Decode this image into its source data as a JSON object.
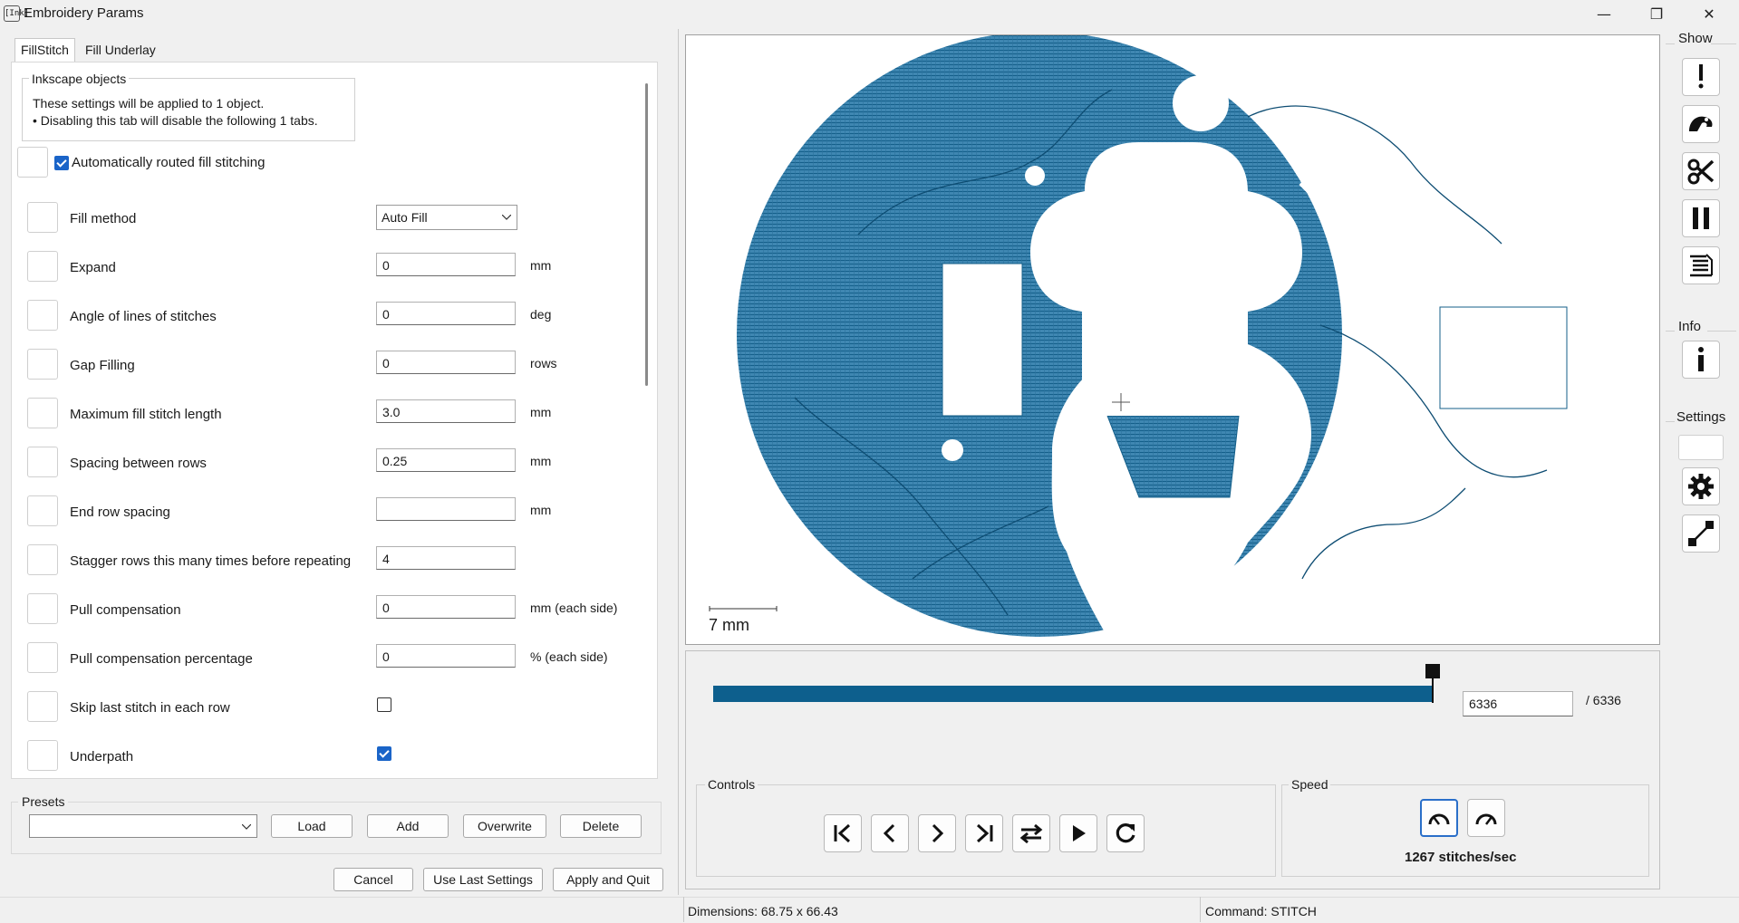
{
  "window": {
    "title": "Embroidery Params",
    "icon_text": "[Ink]",
    "minimize_glyph": "—",
    "restore_glyph": "❐",
    "close_glyph": "✕"
  },
  "tabs": {
    "fill_stitch": "FillStitch",
    "fill_underlay": "Fill Underlay"
  },
  "inkscape_objects": {
    "legend": "Inkscape objects",
    "line1": "These settings will be applied to 1 object.",
    "line2": "• Disabling this tab will disable the following 1 tabs."
  },
  "auto_route": {
    "label": "Automatically routed fill stitching",
    "checked": true
  },
  "params": [
    {
      "label": "Fill method",
      "value": "Auto Fill",
      "unit": ""
    },
    {
      "label": "Expand",
      "value": "0",
      "unit": "mm"
    },
    {
      "label": "Angle of lines of stitches",
      "value": "0",
      "unit": "deg"
    },
    {
      "label": "Gap Filling",
      "value": "0",
      "unit": "rows"
    },
    {
      "label": "Maximum fill stitch length",
      "value": "3.0",
      "unit": "mm"
    },
    {
      "label": "Spacing between rows",
      "value": "0.25",
      "unit": "mm"
    },
    {
      "label": "End row spacing",
      "value": "",
      "unit": "mm"
    },
    {
      "label": "Stagger rows this many times before repeating",
      "value": "4",
      "unit": ""
    },
    {
      "label": "Pull compensation",
      "value": "0",
      "unit": "mm (each side)"
    },
    {
      "label": "Pull compensation percentage",
      "value": "0",
      "unit": "% (each side)"
    },
    {
      "label": "Skip last stitch in each row",
      "checked": false
    },
    {
      "label": "Underpath",
      "checked": true
    }
  ],
  "presets": {
    "legend": "Presets",
    "load": "Load",
    "add": "Add",
    "overwrite": "Overwrite",
    "delete": "Delete"
  },
  "actions": {
    "cancel": "Cancel",
    "use_last": "Use Last Settings",
    "apply_quit": "Apply and Quit"
  },
  "preview": {
    "scale_label": "7 mm",
    "stitch_color": "#1f6f9a",
    "progress_fraction": 1.0,
    "current_stitch": "6336",
    "total_stitches": "/ 6336"
  },
  "controls": {
    "legend": "Controls"
  },
  "speed": {
    "legend": "Speed",
    "value_text": "1267 stitches/sec"
  },
  "sidebar": {
    "show": "Show",
    "info": "Info",
    "settings": "Settings"
  },
  "status": {
    "dimensions": "Dimensions: 68.75 x 66.43",
    "command": "Command: STITCH"
  }
}
